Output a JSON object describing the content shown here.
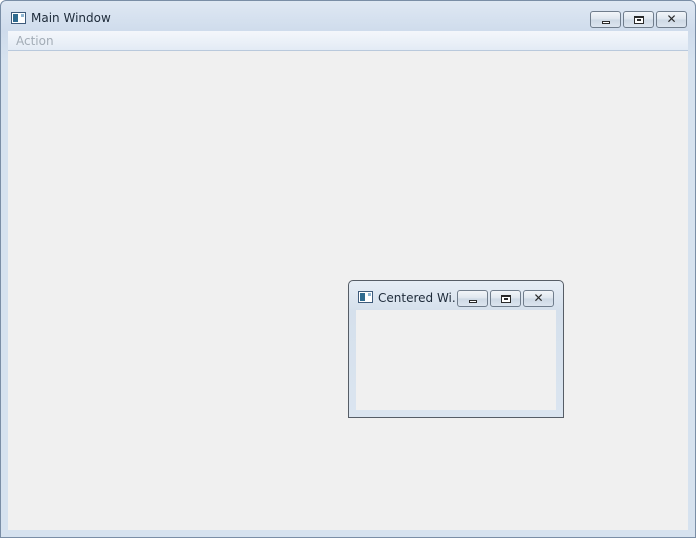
{
  "main_window": {
    "title": "Main Window",
    "menu": {
      "items": [
        {
          "label": "Action"
        }
      ]
    },
    "caption_buttons": {
      "minimize": "minimize-icon",
      "maximize": "restore-icon",
      "close": "close-icon"
    }
  },
  "child_window": {
    "title": "Centered Wi...",
    "caption_buttons": {
      "minimize": "minimize-icon",
      "maximize": "restore-icon",
      "close": "close-icon"
    }
  },
  "colors": {
    "frame": "#d6e2ef",
    "client": "#f0f0f0",
    "disabled_menu_text": "#a3acb6"
  }
}
